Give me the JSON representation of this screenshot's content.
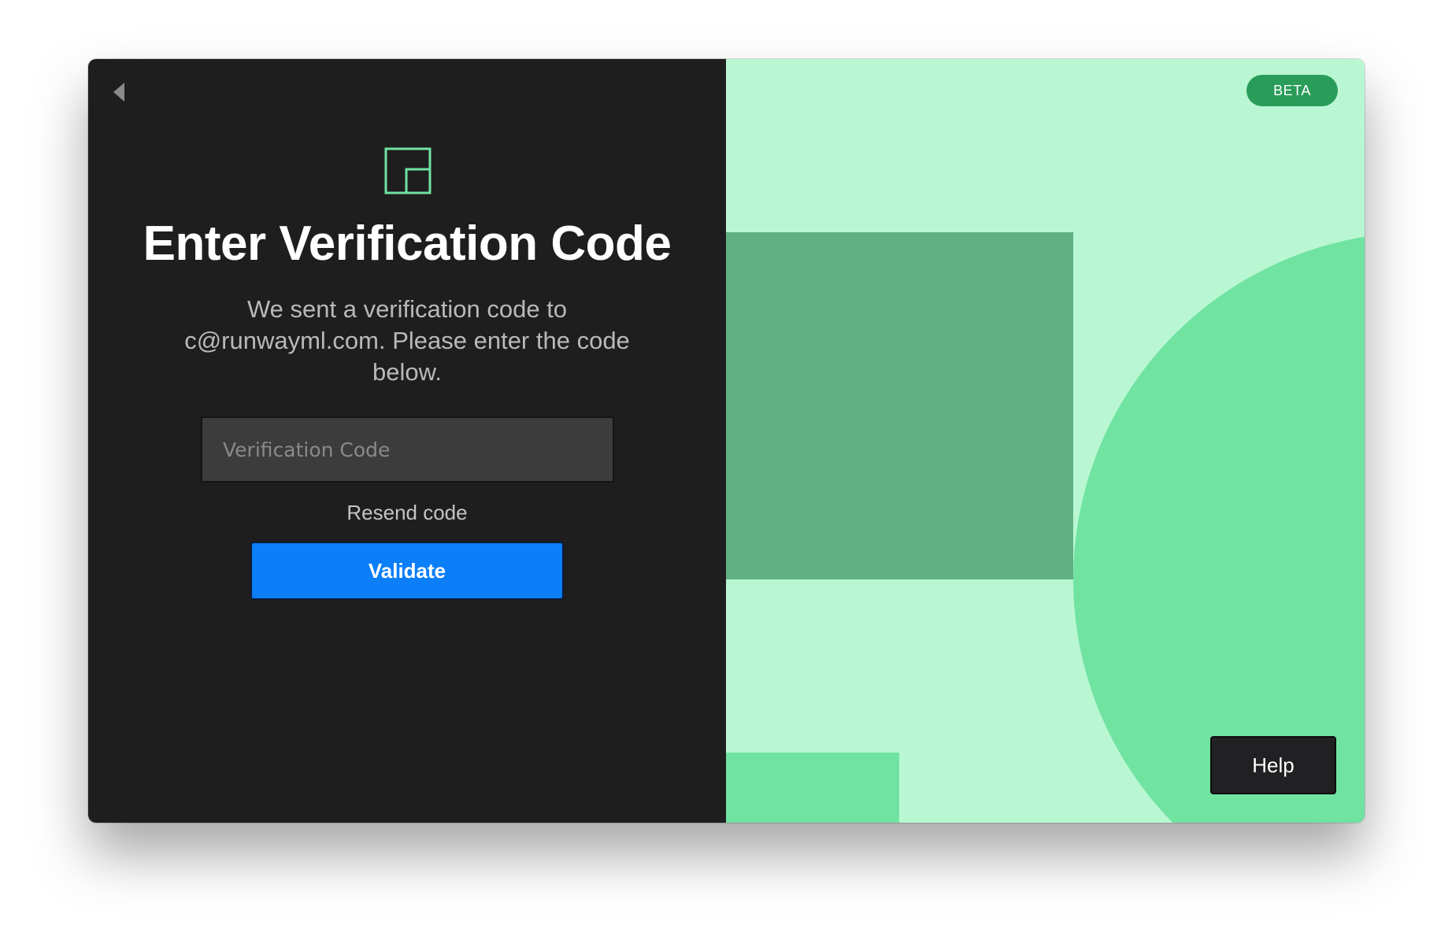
{
  "login": {
    "title": "Enter Verification Code",
    "message": "We sent a verification code to c@runwayml.com. Please enter the code below.",
    "code_placeholder": "Verification Code",
    "code_value": "",
    "resend_label": "Resend code",
    "validate_label": "Validate",
    "back_icon": "chevron-left-icon",
    "logo_icon": "runway-logo-icon"
  },
  "aside": {
    "badge": "BETA",
    "help_label": "Help"
  },
  "colors": {
    "left_bg": "#1e1e1e",
    "accent_blue": "#0b7ef8",
    "logo_green": "#70e3a1",
    "mint_light": "#b9f7d3",
    "mint_mid": "#70e3a1",
    "mint_dark": "#62b083",
    "badge_green": "#2a9c59"
  }
}
